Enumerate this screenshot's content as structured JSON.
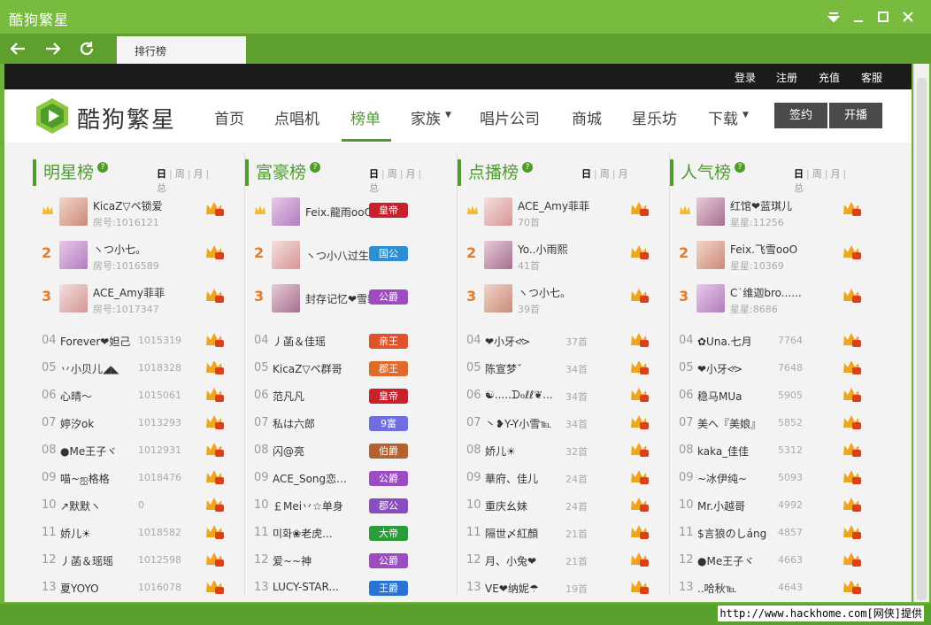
{
  "app": {
    "title": "酷狗繁星"
  },
  "nav": {
    "tab_label": "排行榜"
  },
  "topbar": {
    "login": "登录",
    "register": "注册",
    "recharge": "充值",
    "service": "客服"
  },
  "header": {
    "logo_text": "酷狗繁星",
    "menu": [
      "首页",
      "点唱机",
      "榜单",
      "家族",
      "唱片公司",
      "商城",
      "星乐坊",
      "下载"
    ],
    "menu_active": "榜单",
    "signin": "签约",
    "broadcast": "开播"
  },
  "colors": {
    "accent": "#4e9d2a",
    "titlebar": "#79bb3f",
    "rank_top": "#e57b28"
  },
  "watermark": "http://www.hackhome.com[网侠]提供",
  "columns": [
    {
      "title": "明星榜",
      "tabs": [
        "日",
        "周",
        "月",
        "总"
      ],
      "top3": [
        {
          "name": "KicaZ▽ペ锁爱",
          "sub": "房号:1016121"
        },
        {
          "name": "ヽつ小七。",
          "sub": "房号:1016589"
        },
        {
          "name": "ACE_Amy菲菲",
          "sub": "房号:1017347"
        }
      ],
      "rows": [
        {
          "rank": "04",
          "name": "Forever❤妲己",
          "value": "1015319"
        },
        {
          "rank": "05",
          "name": "丷小贝儿◢◣",
          "value": "1018328"
        },
        {
          "rank": "06",
          "name": "心晴～",
          "value": "1015061"
        },
        {
          "rank": "07",
          "name": "婷汐ok",
          "value": "1013293"
        },
        {
          "rank": "08",
          "name": "●Me王子ヾ",
          "value": "1012931"
        },
        {
          "rank": "09",
          "name": "喵~ஐ格格",
          "value": "1018476"
        },
        {
          "rank": "10",
          "name": "↗默默ヽ",
          "value": "0"
        },
        {
          "rank": "11",
          "name": "娇儿☀",
          "value": "1018582"
        },
        {
          "rank": "12",
          "name": "丿菡＆瑶瑶",
          "value": "1012598"
        },
        {
          "rank": "13",
          "name": "夏YOYO",
          "value": "1016078"
        }
      ]
    },
    {
      "title": "富豪榜",
      "tabs": [
        "日",
        "周",
        "月",
        "总"
      ],
      "top3": [
        {
          "name": "Feix.龍雨ooO",
          "sub": "",
          "badge": "皇帝"
        },
        {
          "name": "ヽつ小八过生日",
          "sub": "",
          "badge": "国公"
        },
        {
          "name": "封存记忆❤雪豹",
          "sub": "",
          "badge": "公爵"
        }
      ],
      "rows": [
        {
          "rank": "04",
          "name": "丿菡＆佳瑶",
          "badge": "亲王"
        },
        {
          "rank": "05",
          "name": "KicaZ▽ペ群哥",
          "badge": "郡王"
        },
        {
          "rank": "06",
          "name": "范凡凡",
          "badge": "皇帝"
        },
        {
          "rank": "07",
          "name": "私は六郎",
          "badge": "9富"
        },
        {
          "rank": "08",
          "name": "闪@亮",
          "badge": "伯爵"
        },
        {
          "rank": "09",
          "name": "ACE_Song恋...",
          "badge": "公爵"
        },
        {
          "rank": "10",
          "name": "￡Mei丷☆单身",
          "badge": "郡公"
        },
        {
          "rank": "11",
          "name": "미화❀老虎...",
          "badge": "大帝"
        },
        {
          "rank": "12",
          "name": "爱~~神",
          "badge": "公爵"
        },
        {
          "rank": "13",
          "name": "LUCY-STAR...",
          "badge": "王爵"
        }
      ]
    },
    {
      "title": "点播榜",
      "tabs": [
        "日",
        "周",
        "月"
      ],
      "top3": [
        {
          "name": "ACE_Amy菲菲",
          "sub": "70首"
        },
        {
          "name": "Yo..小雨熙",
          "sub": "41首"
        },
        {
          "name": "ヽつ小七。",
          "sub": "39首"
        }
      ],
      "rows": [
        {
          "rank": "04",
          "name": "❤小牙<ͯ>",
          "value": "37首"
        },
        {
          "rank": "05",
          "name": "陈宣梦ˇ",
          "value": "34首"
        },
        {
          "rank": "06",
          "name": "☯.....ᗪℴℓℓ❦...",
          "value": "34首"
        },
        {
          "rank": "07",
          "name": "丶❥Y-Y小雪℡",
          "value": "34首"
        },
        {
          "rank": "08",
          "name": "娇儿☀",
          "value": "32首"
        },
        {
          "rank": "09",
          "name": "華府、佳儿",
          "value": "24首"
        },
        {
          "rank": "10",
          "name": "重庆幺妹",
          "value": "24首"
        },
        {
          "rank": "11",
          "name": "隔世〆紅顏",
          "value": "21首"
        },
        {
          "rank": "12",
          "name": "月、小兔❤",
          "value": "21首"
        },
        {
          "rank": "13",
          "name": "VE❤纳妮☂",
          "value": "19首"
        }
      ]
    },
    {
      "title": "人气榜",
      "tabs": [
        "日",
        "周",
        "月",
        "总"
      ],
      "top3": [
        {
          "name": "红馆❤蓝琪儿",
          "sub": "星星:11256"
        },
        {
          "name": "Feix.飞雪ooO",
          "sub": "星星:10369"
        },
        {
          "name": "C˙维迦bro......",
          "sub": "星星:8686"
        }
      ],
      "rows": [
        {
          "rank": "04",
          "name": "✿Una.七月",
          "value": "7764"
        },
        {
          "rank": "05",
          "name": "❤小牙<ͯ>",
          "value": "7648"
        },
        {
          "rank": "06",
          "name": "稳马MUa",
          "value": "5905"
        },
        {
          "rank": "07",
          "name": "美へ『美娘』",
          "value": "5852"
        },
        {
          "rank": "08",
          "name": "kaka_佳佳",
          "value": "5312"
        },
        {
          "rank": "09",
          "name": "~冰伊纯~",
          "value": "5093"
        },
        {
          "rank": "10",
          "name": "Mr.小越哥",
          "value": "4992"
        },
        {
          "rank": "11",
          "name": "$言狼のしáng",
          "value": "4857"
        },
        {
          "rank": "12",
          "name": "●Me王子ヾ",
          "value": "4663"
        },
        {
          "rank": "13",
          "name": "..哈秋℡",
          "value": "4643"
        }
      ]
    }
  ]
}
